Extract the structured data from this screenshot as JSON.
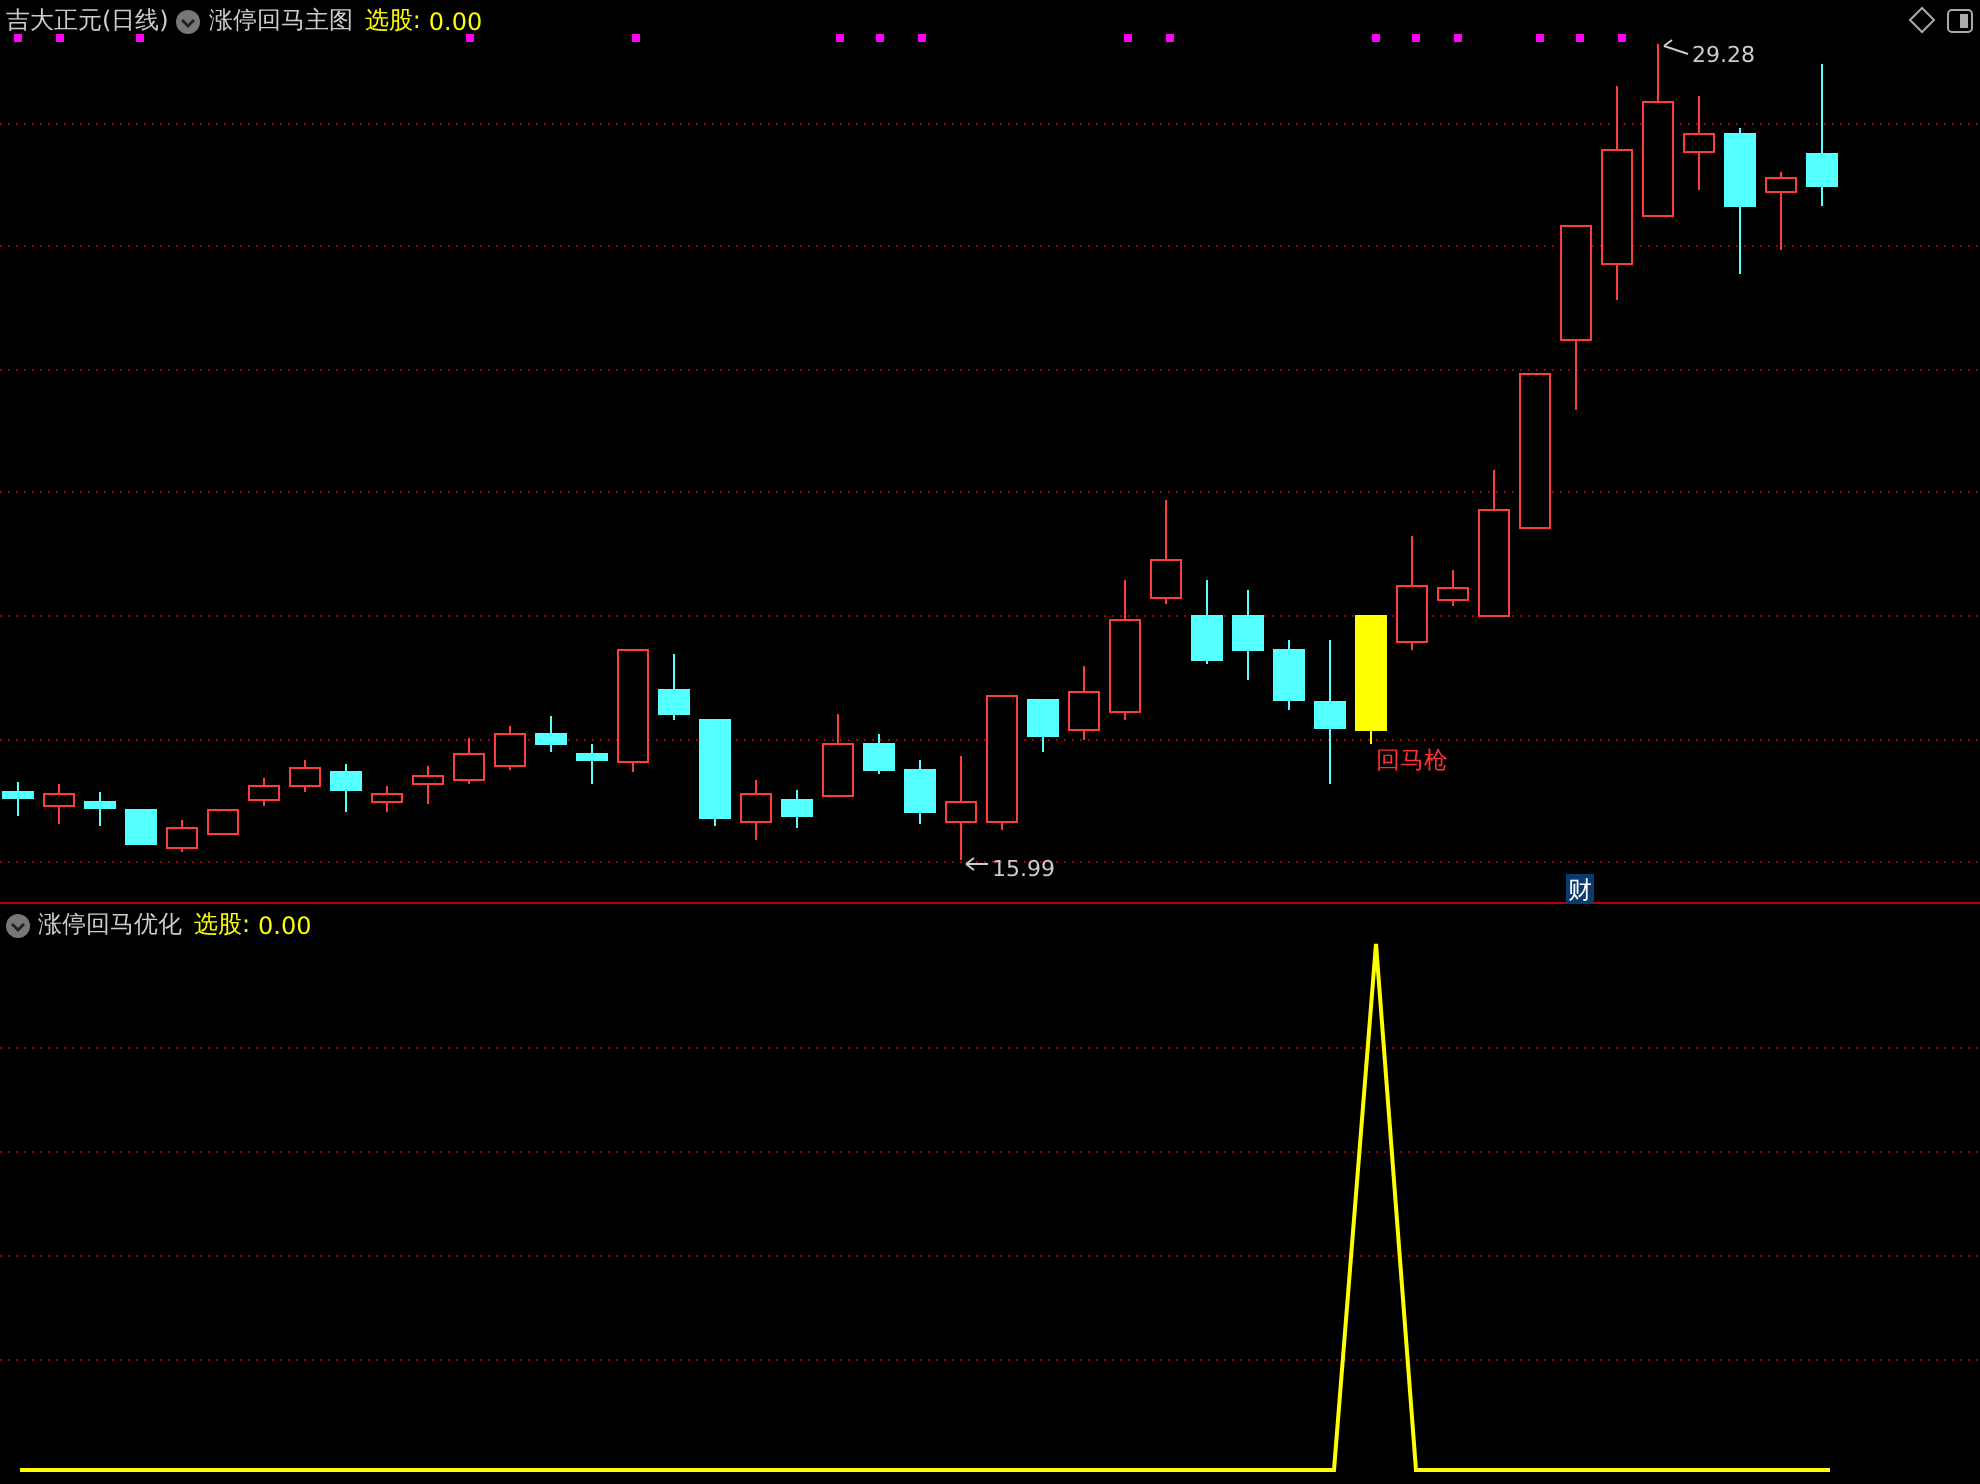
{
  "stock": {
    "name": "吉大正元(日线)"
  },
  "main_panel": {
    "indicator": "涨停回马主图",
    "label": "选股:",
    "value": "0.00",
    "high_label": "29.28",
    "low_label": "15.99",
    "signal_label": "回马枪",
    "event_badge": "财"
  },
  "sub_panel": {
    "indicator": "涨停回马优化",
    "label": "选股:",
    "value": "0.00"
  }
}
